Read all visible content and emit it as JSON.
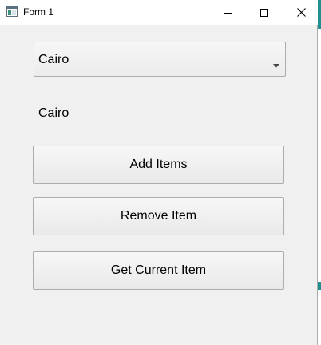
{
  "window": {
    "title": "Form 1",
    "icon": "form-window-icon",
    "controls": {
      "minimize": "minimize-icon",
      "maximize": "maximize-icon",
      "close": "close-icon"
    }
  },
  "combo": {
    "selected": "Cairo",
    "arrow_icon": "chevron-down-icon"
  },
  "label": {
    "current_item": "Cairo"
  },
  "buttons": {
    "add_items": "Add Items",
    "remove_item": "Remove Item",
    "get_current_item": "Get Current Item"
  },
  "colors": {
    "window_bg": "#f0f0f0",
    "titlebar_bg": "#ffffff",
    "accent_strip": "#1f8f8f"
  }
}
